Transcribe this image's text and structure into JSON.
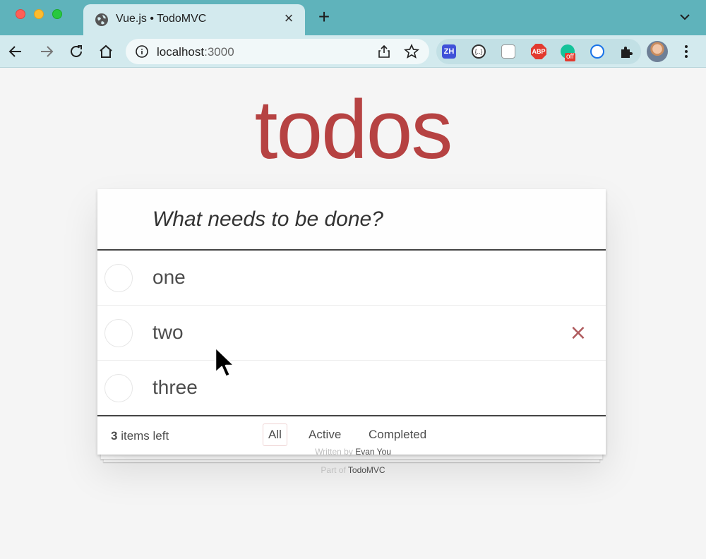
{
  "browser": {
    "tab_title": "Vue.js • TodoMVC",
    "tab_close": "×",
    "new_tab": "+",
    "url_host": "localhost",
    "url_port": ":3000",
    "extensions": {
      "zh_label": "ZH",
      "json_label": "{..}",
      "abp_label": "ABP",
      "grammarly_badge": "off"
    }
  },
  "app": {
    "title": "todos",
    "new_todo_placeholder": "What needs to be done?",
    "todos": [
      {
        "label": "one",
        "completed": false
      },
      {
        "label": "two",
        "completed": false
      },
      {
        "label": "three",
        "completed": false
      }
    ],
    "destroy_glyph": "×",
    "footer": {
      "count": "3",
      "count_suffix": " items left",
      "filters": [
        {
          "label": "All",
          "selected": true
        },
        {
          "label": "Active",
          "selected": false
        },
        {
          "label": "Completed",
          "selected": false
        }
      ]
    }
  },
  "info": {
    "written_by_prefix": "Written by ",
    "author": "Evan You",
    "part_of_prefix": "Part of ",
    "project": "TodoMVC"
  },
  "colors": {
    "title": "#af2f2f",
    "chrome_tab_strip": "#5fb3bb",
    "chrome_toolbar": "#d3eaee",
    "destroy": "#af5b5e"
  }
}
